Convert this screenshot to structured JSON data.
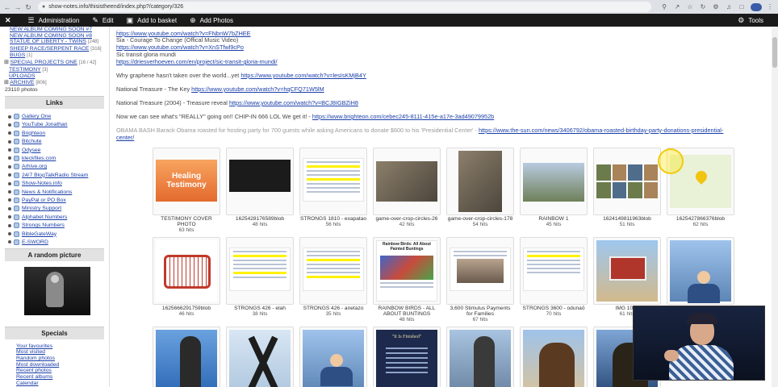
{
  "browser": {
    "url": "show-notes.info/thisistheend/index.php?/category/326"
  },
  "admin_bar": {
    "items": [
      {
        "label": "Administration"
      },
      {
        "label": "Edit"
      },
      {
        "label": "Add to basket"
      },
      {
        "label": "Add Photos"
      }
    ],
    "tools_label": "Tools"
  },
  "sidebar": {
    "categories": [
      {
        "label": "NEW ALBUM COMING SOON #7",
        "count": ""
      },
      {
        "label": "NEW ALBUM COMING SOON #8",
        "count": ""
      },
      {
        "label": "STATUE OF LIBERTY - TWINS",
        "count": "[248]"
      },
      {
        "label": "SHEEP RACE/SERPENT RACE",
        "count": "[316]"
      },
      {
        "label": "BUGS",
        "count": "[1]"
      },
      {
        "label": "SPECIAL PROJECTS ONE",
        "count": "[16 / 42]"
      },
      {
        "label": "TESTIMONY",
        "count": "[3]"
      },
      {
        "label": "UPLOADS",
        "count": ""
      },
      {
        "label": "ARCHIVE",
        "count": "[806]"
      }
    ],
    "photo_count": "23110 photos",
    "links_title": "Links",
    "links": [
      "Gallery One",
      "YouTube Jonathan",
      "Brighteon",
      "Bitchute",
      "Odysee",
      "kleckfiles.com",
      "Arhive.org",
      "24/7 BlogTalkRadio Stream",
      "Show-Notes.info",
      "News & Notifications",
      "PayPal or PO Box",
      "Ministry Support",
      "Alphabet Numbers",
      "Strongs Numbers",
      "BibleGateWay",
      "E-SWORD"
    ],
    "random_title": "A random picture",
    "specials_title": "Specials",
    "specials": [
      "Your favourites",
      "Most visited",
      "Random photos",
      "Most downloaded",
      "Recent photos",
      "Recent albums",
      "Calendar"
    ]
  },
  "description": {
    "lines": [
      {
        "text": "Sia - Courage To Change (Offical Music Video)",
        "link": "https://www.youtube.com/watch?v=FNbnW7bZHEE"
      },
      {
        "text": "",
        "link": "https://www.youtube.com/watch?v=XnSTfwl9cPo"
      },
      {
        "text": "Sic transit gloria mundi",
        "link": "https://driesverhoeven.com/en/project/sic-transit-gloria-mundi/"
      }
    ],
    "graphene": {
      "text": "Why graphene hasn't taken over the world...yet",
      "link": "https://www.youtube.com/watch?v=lesIsKMjB4Y"
    },
    "key": {
      "text": "National Treasure - The Key",
      "link": "https://www.youtube.com/watch?v=hqCFQ71W5lM"
    },
    "reveal": {
      "text": "National Treasure (2004) - Treasure reveal",
      "link": "https://www.youtube.com/watch?v=BCJ8IGBZiH8"
    },
    "chip": {
      "text": "Now we can see what's \"REALLY\" going on!! CHIP-IN 666 LOL We get it! -",
      "link": "https://www.brighteon.com/cebec245-8111-415e-a17e-3ad49079952b"
    },
    "obama": {
      "text": "OBAMA BASH Barack Obama roasted for hosting party for 700 guests while asking Americans to donate $600 to his 'Presidential Center' -",
      "link": "https://www.the-sun.com/news/3406792/obama-roasted-birthday-party-donations-presidential-",
      "link2": "center/"
    }
  },
  "thumbnails": [
    {
      "caption": "TESTIMONY COVER PHOTO",
      "hits": "63 hits",
      "img_text": [
        "Healing",
        "Testimony"
      ]
    },
    {
      "caption": "1625428176589blob",
      "hits": "48 hits"
    },
    {
      "caption": "STRONGS 1810 - exapatao",
      "hits": "56 hits"
    },
    {
      "caption": "game-over-crop-circles-26",
      "hits": "42 hits"
    },
    {
      "caption": "game-over-crop-circles-178",
      "hits": "54 hits"
    },
    {
      "caption": "RAINBOW 1",
      "hits": "45 hits"
    },
    {
      "caption": "1624149811963blob",
      "hits": "51 hits"
    },
    {
      "caption": "1625427866376blob",
      "hits": "62 hits"
    },
    {
      "caption": "1625666291759blob",
      "hits": "46 hits"
    },
    {
      "caption": "STRONGS 426 - elah",
      "hits": "38 hits"
    },
    {
      "caption": "STRONGS 426 - anetazo",
      "hits": "35 hits"
    },
    {
      "caption": "RAINBOW BIRDS - ALL ABOUT BUNTINGS",
      "hits": "48 hits",
      "img_text": [
        "Rainbow Birds: All About Painted Buntings"
      ]
    },
    {
      "caption": "3,600 Stimulus Payments for Families",
      "hits": "67 hits"
    },
    {
      "caption": "STRONGS 3600 - odunaō",
      "hits": "70 hits"
    },
    {
      "caption": "IMG 1042",
      "hits": "61 hits"
    },
    {
      "caption": "",
      "hits": ""
    },
    {
      "caption": "",
      "hits": ""
    },
    {
      "caption": "",
      "hits": ""
    },
    {
      "caption": "",
      "hits": ""
    },
    {
      "caption": "",
      "hits": "",
      "img_text": [
        "\"It Is Finished\""
      ]
    },
    {
      "caption": "",
      "hits": ""
    },
    {
      "caption": "",
      "hits": ""
    },
    {
      "caption": "",
      "hits": ""
    }
  ]
}
